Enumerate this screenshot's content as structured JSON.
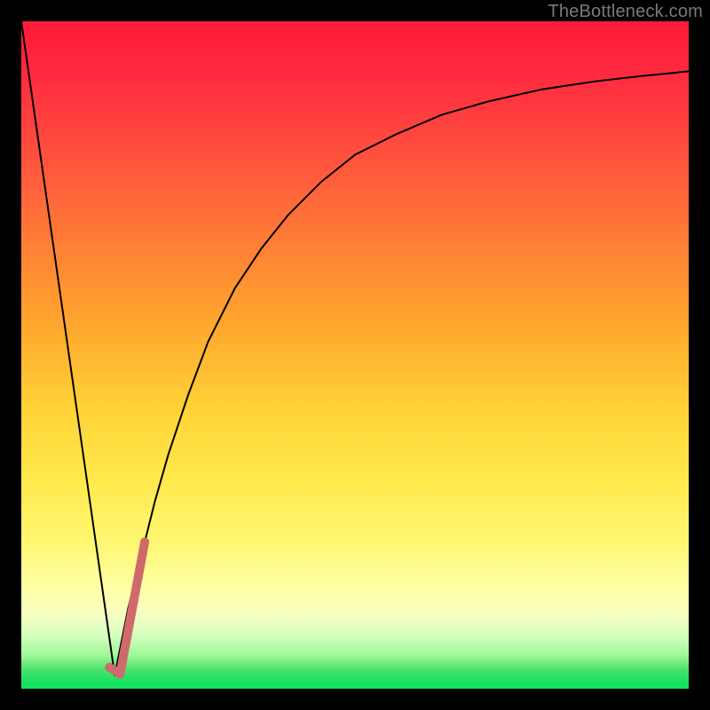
{
  "watermark": "TheBottleneck.com",
  "chart_data": {
    "type": "line",
    "title": "",
    "xlabel": "",
    "ylabel": "",
    "xlim": [
      0,
      100
    ],
    "ylim": [
      0,
      100
    ],
    "grid": false,
    "series": [
      {
        "name": "left-falling-segment",
        "color": "#000000",
        "width": 2,
        "x": [
          0,
          14
        ],
        "values": [
          100,
          2
        ]
      },
      {
        "name": "right-rising-curve",
        "color": "#000000",
        "width": 2,
        "x": [
          14,
          16,
          18,
          20,
          22,
          25,
          28,
          32,
          36,
          40,
          45,
          50,
          56,
          63,
          70,
          78,
          86,
          93,
          100
        ],
        "values": [
          2,
          12,
          20,
          28,
          35,
          44,
          52,
          60,
          66,
          71,
          76,
          80,
          83,
          86,
          88,
          89.8,
          91,
          91.8,
          92.5
        ]
      },
      {
        "name": "hook-marker",
        "color": "#d06a6a",
        "width": 10,
        "x": [
          13.2,
          14.8,
          18.5
        ],
        "values": [
          3.2,
          2.2,
          22
        ]
      }
    ]
  }
}
